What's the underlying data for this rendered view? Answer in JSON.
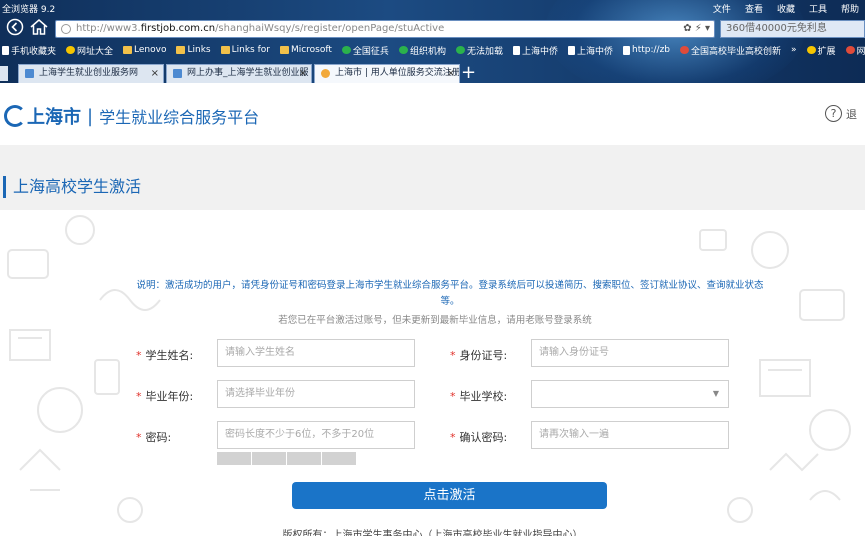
{
  "browser": {
    "app_title": "全浏览器 9.2",
    "menus": [
      "文件",
      "查看",
      "收藏",
      "工具",
      "帮助"
    ],
    "url_prefix": "http://www3.",
    "url_domain": "firstjob.com.cn",
    "url_path": "/shanghaiWsqy/s/register/openPage/stuActive",
    "search_value": "360借40000元免利息",
    "bookmarks": [
      "手机收藏夹",
      "网址大全",
      "Lenovo",
      "Links",
      "Links for",
      "Microsoft",
      "全国征兵",
      "组织机构",
      "无法加载",
      "上海中侨",
      "上海中侨",
      "http://zb",
      "全国高校毕业高校创新",
      "»",
      "扩展",
      "网银"
    ],
    "tabs": [
      {
        "title": "上海学生就业创业服务网"
      },
      {
        "title": "网上办事_上海学生就业创业服"
      },
      {
        "title": "上海市 | 用人单位服务交流注册"
      }
    ],
    "tab_close": "×",
    "new_tab": "+"
  },
  "header": {
    "city_logo_text": "上海市",
    "separator": "|",
    "subtitle": "学生就业综合服务平台",
    "help_mark": "?",
    "help_text": "退"
  },
  "section": {
    "title": "上海高校学生激活"
  },
  "form": {
    "note_line1": "说明：激活成功的用户，请凭身份证号和密码登录上海市学生就业综合服务平台。登录系统后可以投递简历、搜索职位、签订就业协议、查询就业状态",
    "note_line2": "等。",
    "note_sub": "若您已在平台激活过账号，但未更新到最新毕业信息，请用老账号登录系统",
    "required_mark": "*",
    "fields": {
      "name": {
        "label": "学生姓名:",
        "placeholder": "请输入学生姓名"
      },
      "id_number": {
        "label": "身份证号:",
        "placeholder": "请输入身份证号"
      },
      "grad_year": {
        "label": "毕业年份:",
        "placeholder": "请选择毕业年份"
      },
      "school": {
        "label": "毕业学校:",
        "placeholder": ""
      },
      "password": {
        "label": "密码:",
        "placeholder": "密码长度不少于6位，不多于20位"
      },
      "confirm_password": {
        "label": "确认密码:",
        "placeholder": "请再次输入一遍"
      }
    },
    "submit_label": "点击激活",
    "footer": "版权所有：上海市学生事务中心（上海市高校毕业生就业指导中心）"
  },
  "colors": {
    "brand": "#1b67b5",
    "button": "#1a74c8",
    "required": "#e0312a"
  }
}
